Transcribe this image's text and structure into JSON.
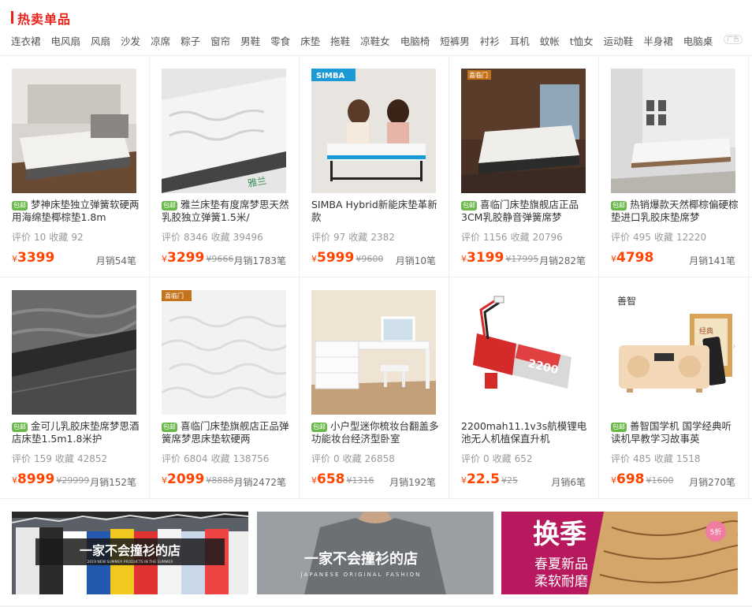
{
  "section": {
    "title": "热卖单品",
    "ad_label": "广告"
  },
  "tags": [
    "连衣裙",
    "电风扇",
    "风扇",
    "沙发",
    "凉席",
    "粽子",
    "窗帘",
    "男鞋",
    "零食",
    "床垫",
    "拖鞋",
    "凉鞋女",
    "电脑椅",
    "短裤男",
    "衬衫",
    "耳机",
    "蚊帐",
    "t恤女",
    "运动鞋",
    "半身裙",
    "电脑桌"
  ],
  "products": [
    {
      "baoyou": "包邮",
      "name": "梦神床垫独立弹簧软硬两用海绵垫椰棕垫1.8m",
      "rating_label": "评价",
      "rating": "10",
      "fav_label": "收藏",
      "fav": "92",
      "yen": "¥",
      "price": "3399",
      "old_price": "",
      "sales": "月销54笔",
      "image": "bed-room-icon"
    },
    {
      "baoyou": "包邮",
      "name": "雅兰床垫有度席梦思天然乳胶独立弹簧1.5米/",
      "rating_label": "评价",
      "rating": "8346",
      "fav_label": "收藏",
      "fav": "39496",
      "yen": "¥",
      "price": "3299",
      "old_price": "¥9666",
      "sales": "月销1783笔",
      "image": "mattress-closeup-icon"
    },
    {
      "baoyou": "",
      "name": "SIMBA Hybrid新能床垫革新款",
      "rating_label": "评价",
      "rating": "97",
      "fav_label": "收藏",
      "fav": "2382",
      "yen": "¥",
      "price": "5999",
      "old_price": "¥9600",
      "sales": "月销10笔",
      "image": "simba-bed-icon"
    },
    {
      "baoyou": "包邮",
      "name": "喜临门床垫旗舰店正品3CM乳胶静音弹簧席梦",
      "rating_label": "评价",
      "rating": "1156",
      "fav_label": "收藏",
      "fav": "20796",
      "yen": "¥",
      "price": "3199",
      "old_price": "¥17995",
      "sales": "月销282笔",
      "image": "dark-bedroom-icon"
    },
    {
      "baoyou": "包邮",
      "name": "热销爆款天然椰棕偏硬棕垫进口乳胶床垫席梦",
      "rating_label": "评价",
      "rating": "495",
      "fav_label": "收藏",
      "fav": "12220",
      "yen": "¥",
      "price": "4798",
      "old_price": "",
      "sales": "月销141笔",
      "image": "bright-bedroom-icon"
    },
    {
      "baoyou": "包邮",
      "name": "金可儿乳胶床垫席梦思酒店床垫1.5m1.8米护",
      "rating_label": "评价",
      "rating": "159",
      "fav_label": "收藏",
      "fav": "42852",
      "yen": "¥",
      "price": "8999",
      "old_price": "¥29999",
      "sales": "月销152笔",
      "image": "mattress-edge-icon"
    },
    {
      "baoyou": "包邮",
      "name": "喜临门床垫旗舰店正品弹簧席梦思床垫软硬两",
      "rating_label": "评价",
      "rating": "6804",
      "fav_label": "收藏",
      "fav": "138756",
      "yen": "¥",
      "price": "2099",
      "old_price": "¥8888",
      "sales": "月销2472笔",
      "image": "white-mattress-icon"
    },
    {
      "baoyou": "包邮",
      "name": "小户型迷你梳妆台翻盖多功能妆台经济型卧室",
      "rating_label": "评价",
      "rating": "0",
      "fav_label": "收藏",
      "fav": "26858",
      "yen": "¥",
      "price": "658",
      "old_price": "¥1316",
      "sales": "月销192笔",
      "image": "dressing-table-icon"
    },
    {
      "baoyou": "",
      "name": "2200mah11.1v3s航模锂电池无人机植保直升机",
      "rating_label": "评价",
      "rating": "0",
      "fav_label": "收藏",
      "fav": "652",
      "yen": "¥",
      "price": "22.5",
      "old_price": "¥25",
      "sales": "月销6笔",
      "image": "lipo-battery-icon"
    },
    {
      "baoyou": "包邮",
      "name": "善智国学机 国学经典听读机早教学习故事英",
      "rating_label": "评价",
      "rating": "485",
      "fav_label": "收藏",
      "fav": "1518",
      "yen": "¥",
      "price": "698",
      "old_price": "¥1600",
      "sales": "月销270笔",
      "image": "radio-player-icon"
    }
  ],
  "image_text": {
    "simba_logo": "SIMBA",
    "brand_xilinmen": "喜临门",
    "mattress_brand": "雅兰",
    "battery_text": "2200",
    "shanzhi_logo": "善智",
    "book_title": "经典"
  },
  "banners": [
    {
      "text": "一家不会撞衫的店",
      "sub": "2019 NEW SUMMER PRODUCTS IN THE SUMMER"
    },
    {
      "text": "一家不会撞衫的店",
      "sub": "JAPANESE ORIGINAL FASHION"
    },
    {
      "text": "换季",
      "sub1": "春夏新品",
      "sub2": "柔软耐磨",
      "badge": "5折"
    }
  ]
}
